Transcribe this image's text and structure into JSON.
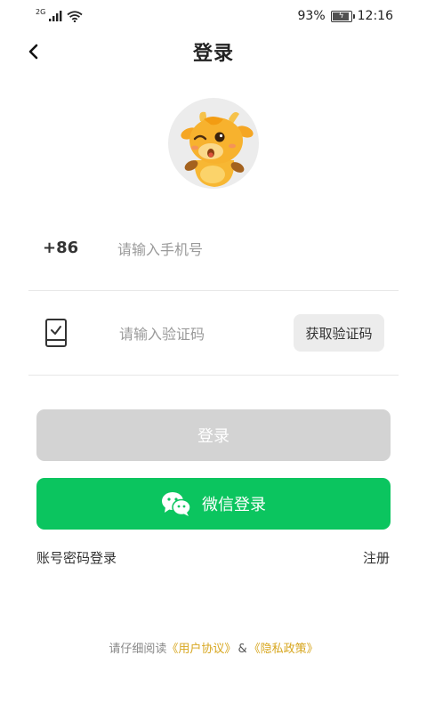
{
  "status_bar": {
    "network": "2G",
    "battery_percent": "93%",
    "time": "12:16"
  },
  "header": {
    "title": "登录",
    "back_icon": "chevron-left-icon"
  },
  "form": {
    "country_code": "+86",
    "phone_placeholder": "请输入手机号",
    "code_placeholder": "请输入验证码",
    "get_code_label": "获取验证码"
  },
  "buttons": {
    "login_label": "登录",
    "wechat_login_label": "微信登录"
  },
  "links": {
    "account_password_login": "账号密码登录",
    "register": "注册"
  },
  "agreement": {
    "prefix": "请仔细阅读",
    "user_agreement": "《用户协议》",
    "separator": "&",
    "privacy_policy": "《隐私政策》"
  },
  "colors": {
    "wechat_green": "#0bc55f",
    "disabled_gray": "#d3d3d3",
    "link_gold": "#d7a61e"
  }
}
